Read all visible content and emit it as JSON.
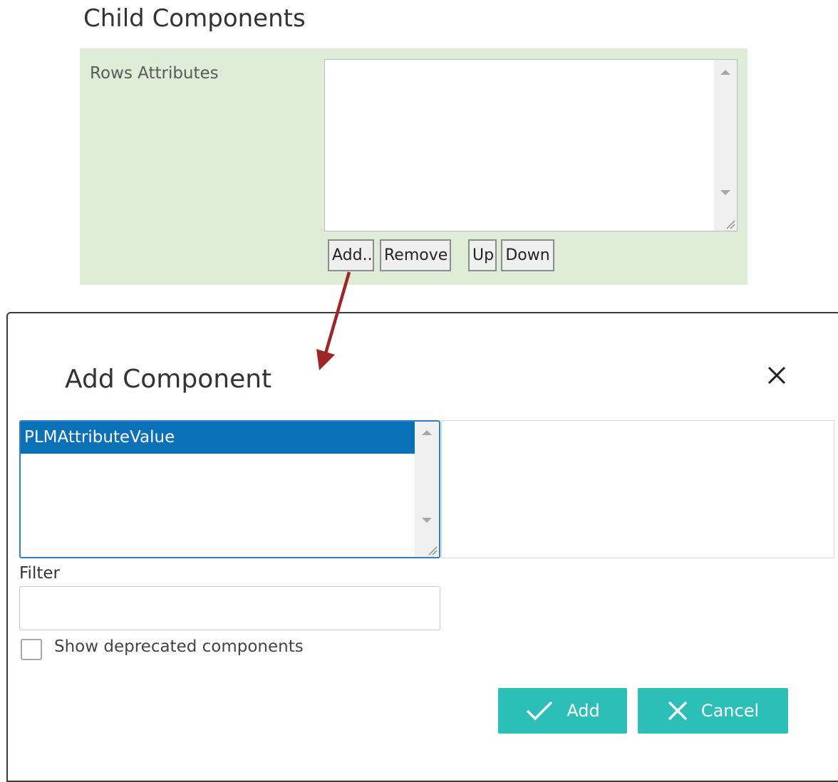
{
  "section": {
    "title": "Child Components",
    "rows_label": "Rows Attributes",
    "buttons": {
      "add": "Add..",
      "remove": "Remove",
      "up": "Up",
      "down": "Down"
    }
  },
  "dialog": {
    "title": "Add Component",
    "close_icon": "close-icon",
    "list_items": [
      "PLMAttributeValue"
    ],
    "selected_item": "PLMAttributeValue",
    "filter_label": "Filter",
    "filter_value": "",
    "show_deprecated_label": "Show deprecated components",
    "show_deprecated_checked": false,
    "add_label": "Add",
    "cancel_label": "Cancel"
  },
  "colors": {
    "panel_bg": "#dfecd7",
    "accent_button": "#2bbfb8",
    "selection": "#0a70b8",
    "arrow": "#a02525"
  }
}
